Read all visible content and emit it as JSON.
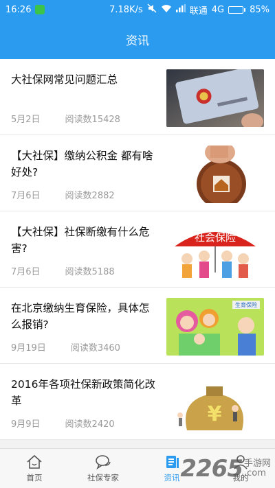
{
  "status_bar": {
    "time": "16:26",
    "speed": "7.18K/s",
    "carrier": "联通",
    "network": "4G",
    "battery": "85%",
    "battery_level": 0.85
  },
  "header": {
    "title": "资讯"
  },
  "articles": [
    {
      "title": "大社保网常见问题汇总",
      "date": "5月2日",
      "reads": "阅读数15428",
      "image": "social-security-card-image"
    },
    {
      "title": "【大社保】缴纳公积金 都有啥好处?",
      "date": "7月6日",
      "reads": "阅读数2882",
      "image": "coin-house-image"
    },
    {
      "title": "【大社保】社保断缴有什么危害?",
      "date": "7月6日",
      "reads": "阅读数5188",
      "image": "social-insurance-umbrella-image",
      "image_text": "社会保险"
    },
    {
      "title": "在北京缴纳生育保险，具体怎么报销?",
      "date": "9月19日",
      "reads": "阅读数3460",
      "image": "maternity-insurance-family-image",
      "image_text": "生育保险"
    },
    {
      "title": "2016年各项社保新政策简化改革",
      "date": "9月9日",
      "reads": "阅读数2420",
      "image": "money-bag-image"
    }
  ],
  "tabbar": {
    "tabs": [
      {
        "label": "首页",
        "icon": "home-icon",
        "active": false
      },
      {
        "label": "社保专家",
        "icon": "chat-bubbles-icon",
        "active": false
      },
      {
        "label": "资讯",
        "icon": "news-icon",
        "active": true
      },
      {
        "label": "我的",
        "icon": "person-icon",
        "active": false
      }
    ]
  },
  "watermark": {
    "big": "2265",
    "small_top": "手游网",
    "small_bottom": ".com"
  },
  "colors": {
    "accent": "#2b9bf0",
    "meta_text": "#9a9a9a",
    "active_tab": "#2b9bf0"
  }
}
